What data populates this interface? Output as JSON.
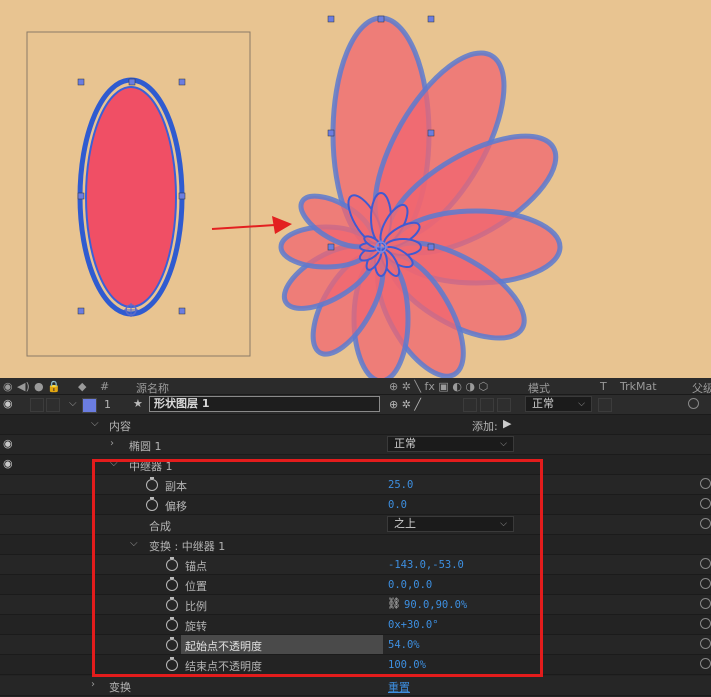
{
  "colors": {
    "canvas_bg": "#e8c491",
    "fill": "#f04f65",
    "stroke": "#2f5bd0",
    "petal_fill": "#f06570",
    "accent_blue": "#3d8fe0",
    "red_box": "#e31c1c",
    "arrow": "#e32020"
  },
  "header": {
    "col_hash": "#",
    "col_source_name": "源名称",
    "col_mode": "模式",
    "col_t": "T",
    "col_trkmat": "TrkMat",
    "col_parent": "父级"
  },
  "layer": {
    "index": "1",
    "name": "形状图层 1",
    "mode": "正常"
  },
  "contents": {
    "label": "内容",
    "add_label": "添加:",
    "ellipse_label": "椭圆 1",
    "ellipse_mode": "正常",
    "repeater_label": "中继器 1"
  },
  "repeater": {
    "copies_label": "副本",
    "copies_value": "25.0",
    "offset_label": "偏移",
    "offset_value": "0.0",
    "composite_label": "合成",
    "composite_value": "之上",
    "transform_label": "变换 : 中继器 1",
    "anchor_label": "锚点",
    "anchor_value": "-143.0,-53.0",
    "position_label": "位置",
    "position_value": "0.0,0.0",
    "scale_label": "比例",
    "scale_value": "90.0,90.0%",
    "rotation_label": "旋转",
    "rotation_value": "0x+30.0°",
    "start_opacity_label": "起始点不透明度",
    "start_opacity_value": "54.0%",
    "end_opacity_label": "结束点不透明度",
    "end_opacity_value": "100.0%"
  },
  "transform": {
    "label": "变换",
    "reset_label": "重置"
  },
  "icons": [
    "eye-icon",
    "speaker-icon",
    "solo-icon",
    "lock-icon",
    "label-icon",
    "star-icon",
    "stopwatch-icon",
    "chevron-icon",
    "link-icon",
    "spiral-icon",
    "arrow-icon"
  ]
}
